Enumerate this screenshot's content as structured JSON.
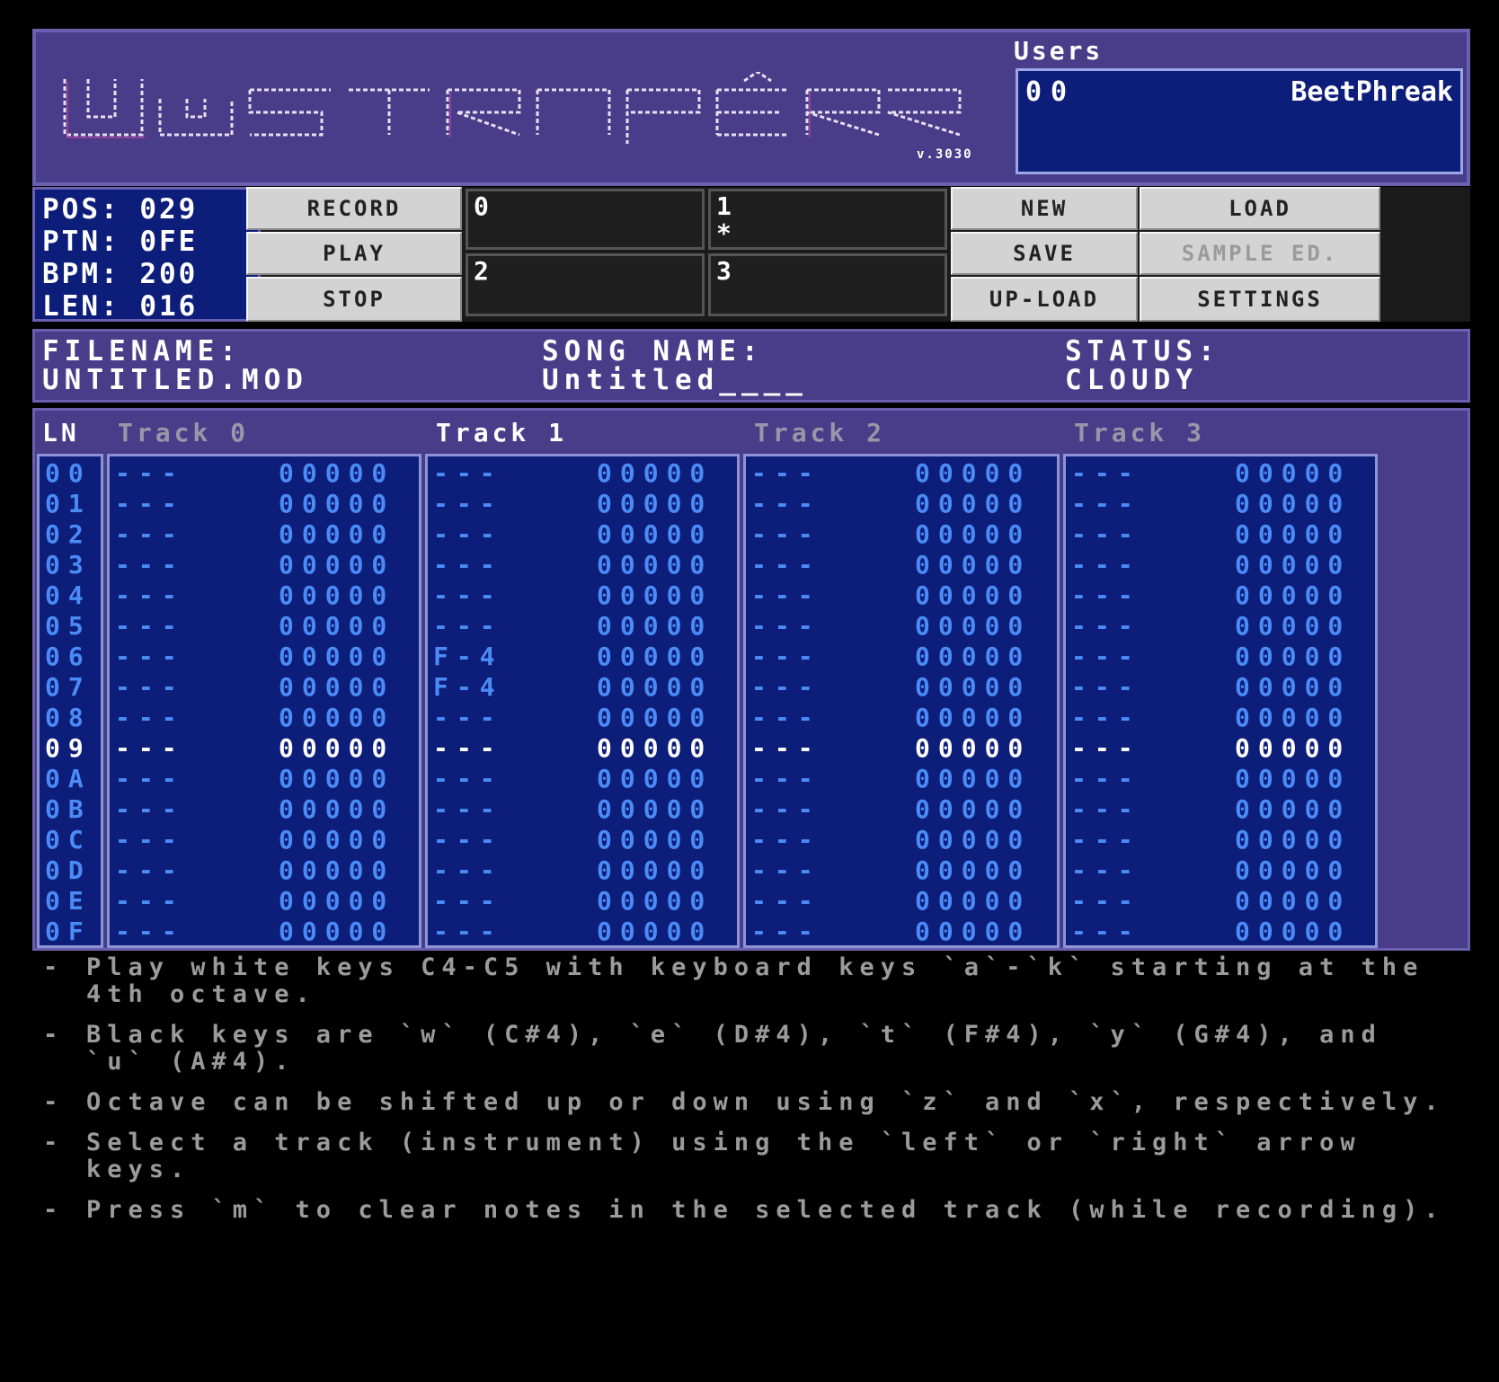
{
  "app": {
    "logo_text": "WUTRACKER",
    "version": "v.3030"
  },
  "users": {
    "title": "Users",
    "list": [
      {
        "id": "00",
        "name": "BeetPhreak"
      }
    ]
  },
  "stats": {
    "pos": "POS: 029",
    "ptn": "PTN: 0FE",
    "bpm": "BPM: 200",
    "len": "LEN: 016"
  },
  "buttons": {
    "record": "RECORD",
    "play": "PLAY",
    "stop": "STOP",
    "new": "NEW",
    "load": "LOAD",
    "save": "SAVE",
    "sample_ed": "SAMPLE ED.",
    "upload": "UP-LOAD",
    "settings": "SETTINGS"
  },
  "slots": [
    {
      "num": "0",
      "mark": ""
    },
    {
      "num": "1",
      "mark": "*"
    },
    {
      "num": "2",
      "mark": ""
    },
    {
      "num": "3",
      "mark": ""
    }
  ],
  "info": {
    "filename_label": "FILENAME:",
    "filename": "UNTITLED.MOD",
    "songname_label": "SONG NAME:",
    "songname": "Untitled____",
    "status_label": "STATUS:",
    "status": "CLOUDY"
  },
  "pattern": {
    "ln_label": "LN",
    "tracks": [
      "Track 0",
      "Track 1",
      "Track 2",
      "Track 3"
    ],
    "selected_track": 1,
    "highlight_row": 9,
    "rows": [
      "00",
      "01",
      "02",
      "03",
      "04",
      "05",
      "06",
      "07",
      "08",
      "09",
      "0A",
      "0B",
      "0C",
      "0D",
      "0E",
      "0F"
    ],
    "empty_note": "---",
    "empty_fx": "00000",
    "notes": {
      "1": {
        "6": "F-4",
        "7": "F-4"
      }
    }
  },
  "help": [
    "Play white keys C4-C5 with keyboard keys `a`-`k` starting at the 4th octave.",
    "Black keys are `w` (C#4), `e` (D#4), `t` (F#4), `y` (G#4), and `u` (A#4).",
    "Octave can be shifted up or down using `z` and `x`, respectively.",
    "Select a track (instrument) using the `left` or `right` arrow keys.",
    "Press `m` to clear notes in the selected track (while recording)."
  ],
  "colors": {
    "panel": "#493d8a",
    "pattern_bg": "#0d1d7a",
    "note": "#4b8bf5",
    "button": "#d3d3d3"
  }
}
